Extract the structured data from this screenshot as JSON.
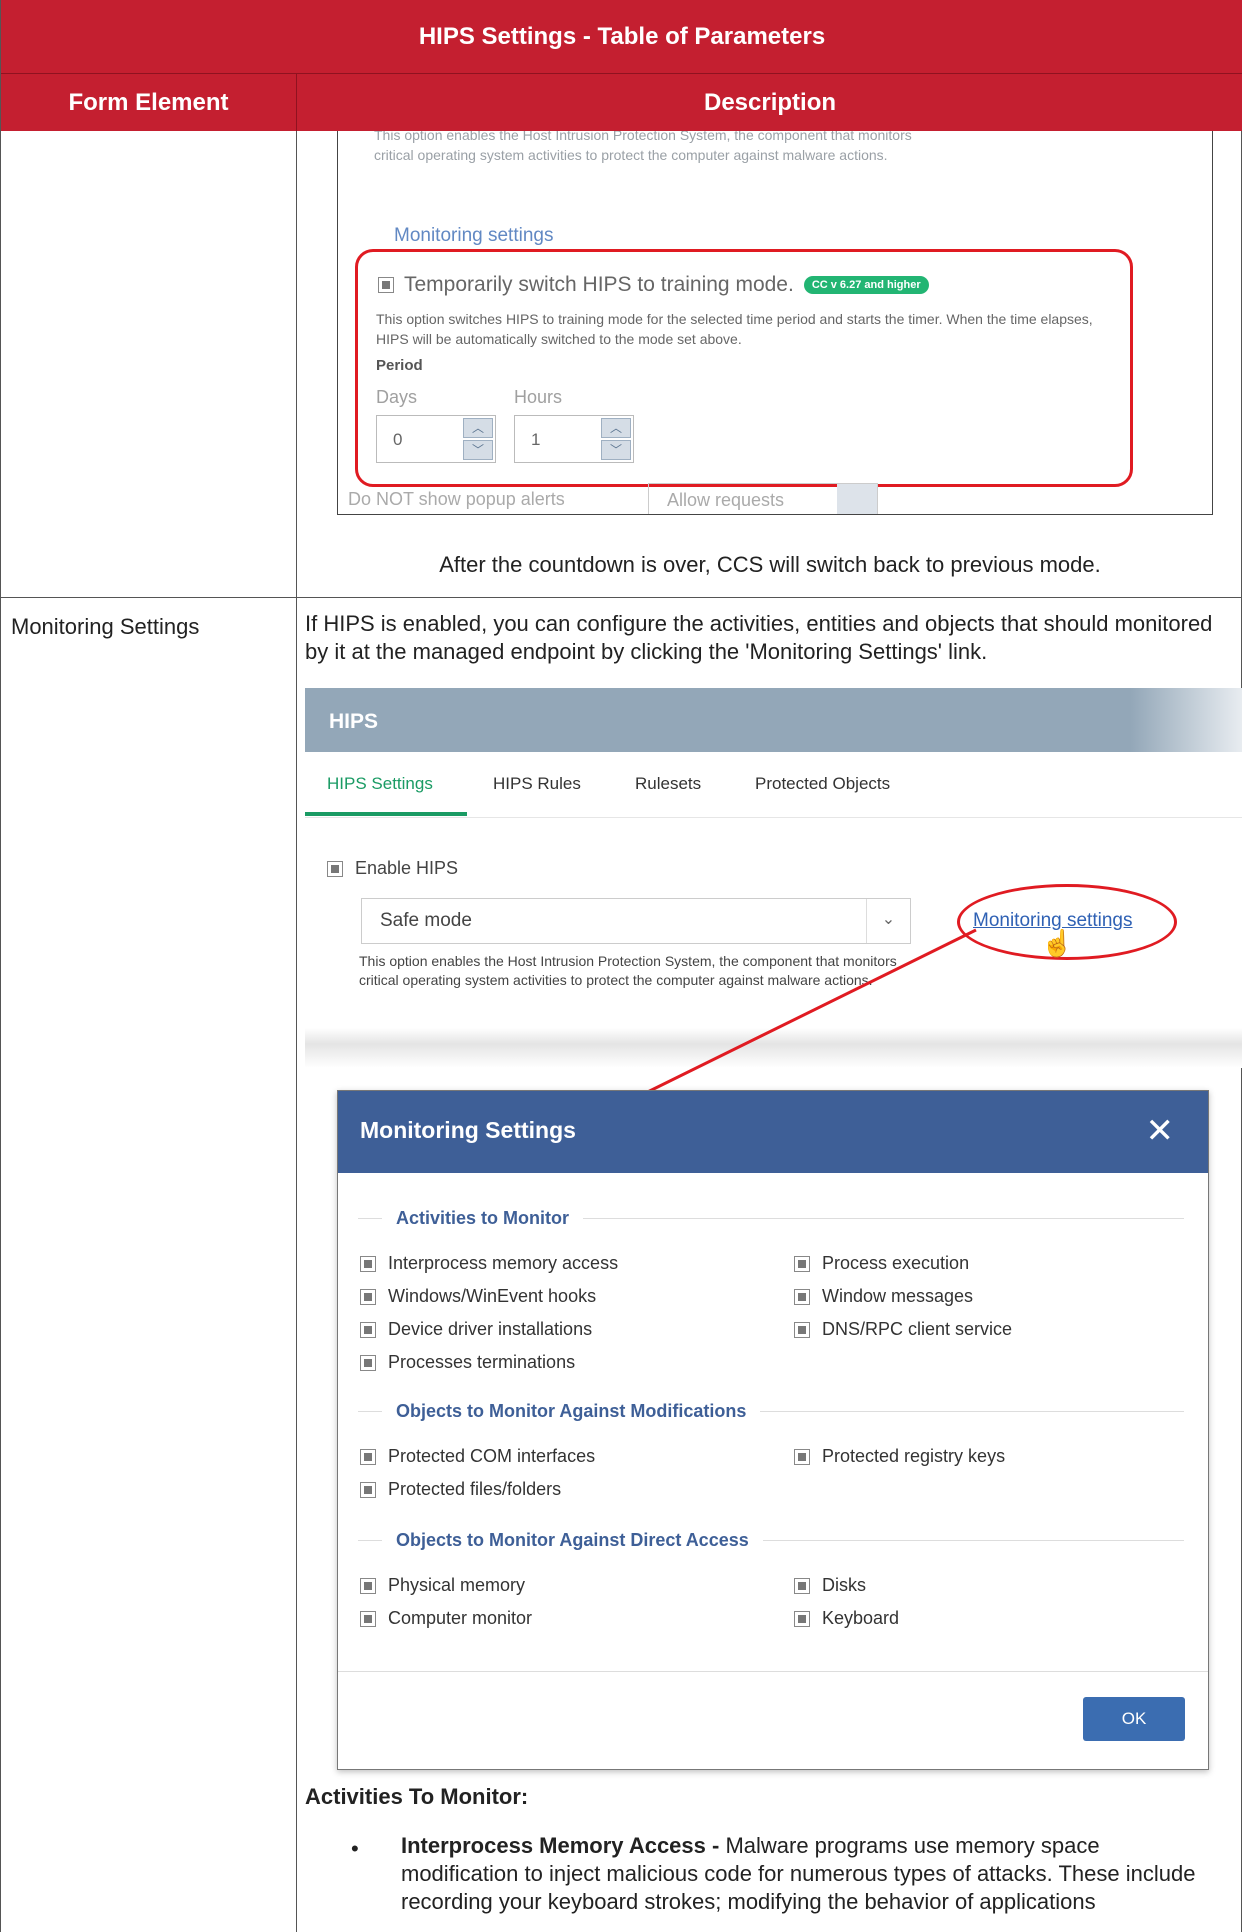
{
  "table": {
    "title": "HIPS Settings - Table of Parameters",
    "col_form_element": "Form Element",
    "col_description": "Description"
  },
  "row1": {
    "screenshot": {
      "faded_desc": "This option enables the Host Intrusion Protection System, the component that monitors critical operating system activities to protect the computer against malware actions.",
      "monitoring_link": "Monitoring settings",
      "temp_label": "Temporarily switch HIPS to training mode.",
      "badge": "CC v 6.27 and higher",
      "option_desc": "This option switches HIPS to training mode for the selected time period and starts the timer. When the time elapses, HIPS will be automatically switched to the mode set above.",
      "period_label": "Period",
      "days_label": "Days",
      "hours_label": "Hours",
      "days_value": "0",
      "hours_value": "1",
      "bottom_faded": "Do NOT show popup alerts",
      "bottom_select": "Allow requests"
    },
    "after_text": "After the countdown is over, CCS will switch back to previous mode."
  },
  "row2": {
    "label": "Monitoring Settings",
    "description": "If HIPS is enabled, you can configure the activities, entities and objects that should monitored by it at the managed endpoint by clicking the 'Monitoring Settings' link.",
    "hips": {
      "title": "HIPS",
      "tabs": [
        "HIPS Settings",
        "HIPS Rules",
        "Rulesets",
        "Protected Objects"
      ],
      "enable_label": "Enable HIPS",
      "mode_value": "Safe mode",
      "desc": "This option enables the Host Intrusion Protection System, the component that monitors critical operating system activities to protect the computer against malware actions.",
      "link": "Monitoring settings"
    },
    "dialog": {
      "title": "Monitoring Settings",
      "sections": [
        {
          "heading": "Activities to Monitor",
          "left": [
            "Interprocess memory access",
            "Windows/WinEvent hooks",
            "Device driver installations",
            "Processes terminations"
          ],
          "right": [
            "Process execution",
            "Window messages",
            "DNS/RPC client service"
          ]
        },
        {
          "heading": "Objects to Monitor Against Modifications",
          "left": [
            "Protected COM interfaces",
            "Protected files/folders"
          ],
          "right": [
            "Protected registry keys"
          ]
        },
        {
          "heading": "Objects to Monitor Against Direct Access",
          "left": [
            "Physical memory",
            "Computer monitor"
          ],
          "right": [
            "Disks",
            "Keyboard"
          ]
        }
      ],
      "ok_label": "OK"
    },
    "activities_heading": "Activities To Monitor:",
    "bullet_title": "Interprocess Memory Access - ",
    "bullet_text": "Malware programs use memory space modification to inject malicious code for numerous types of attacks. These include recording your keyboard strokes; modifying the behavior of applications"
  },
  "colors": {
    "header_red": "#c41f30",
    "dialog_blue": "#3e5f97",
    "link_blue": "#2f61b4",
    "highlight_red": "#e01b22",
    "badge_green": "#22b573",
    "tab_green": "#1a9b64"
  }
}
